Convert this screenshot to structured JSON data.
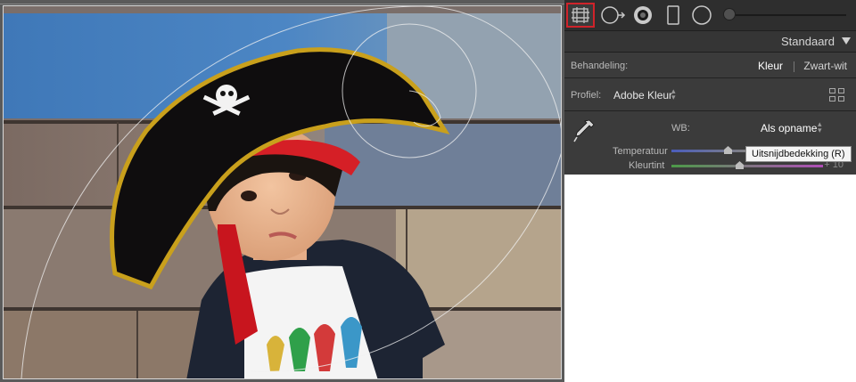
{
  "toolstrip": {
    "tools": [
      {
        "name": "crop-overlay",
        "icon": "crop-grid-icon",
        "active": true
      },
      {
        "name": "spot-removal",
        "icon": "spot-removal-icon"
      },
      {
        "name": "red-eye",
        "icon": "red-eye-icon"
      },
      {
        "name": "graduated-filter",
        "icon": "graduated-filter-icon"
      },
      {
        "name": "radial-filter",
        "icon": "radial-filter-icon"
      },
      {
        "name": "adjustment-brush",
        "icon": "adjustment-brush-slider"
      }
    ]
  },
  "panel": {
    "preset": "Standaard",
    "treatment": {
      "label": "Behandeling:",
      "color": "Kleur",
      "bw": "Zwart-wit"
    },
    "profile": {
      "label": "Profiel:",
      "value": "Adobe Kleur"
    },
    "wb": {
      "label": "WB:",
      "value": "Als opname",
      "temperature_label": "Temperatuur",
      "tint_label": "Kleurtint",
      "tint_value": "+ 10"
    }
  },
  "tooltip": "Uitsnijdbedekking (R)",
  "colors": {
    "accent_active": "#d0232a",
    "panel_bg": "#3b3b3b",
    "toolstrip_bg": "#2e2e2e"
  }
}
